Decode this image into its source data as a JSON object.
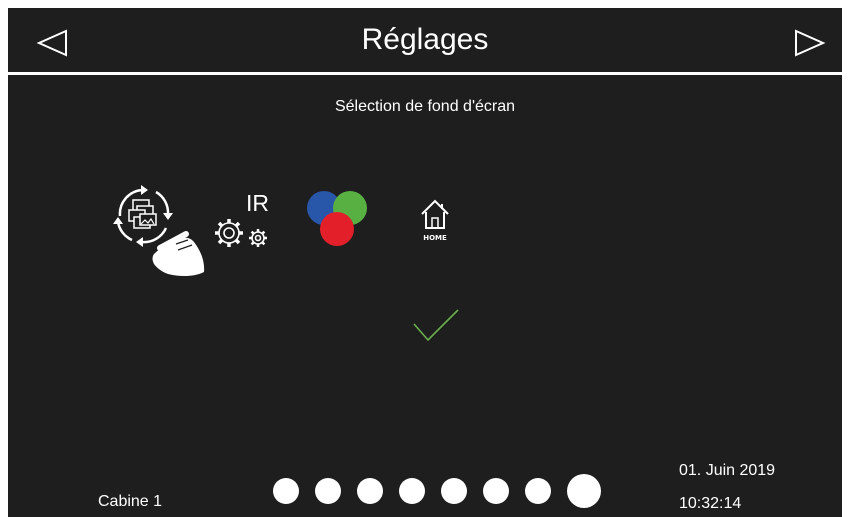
{
  "header": {
    "title": "Réglages",
    "prev_icon": "triangle-left-icon",
    "next_icon": "triangle-right-icon"
  },
  "main": {
    "subtitle": "Sélection de fond d'écran",
    "icons": [
      {
        "name": "wallpaper-swipe-icon"
      },
      {
        "name": "ir-settings-icon",
        "label": "IR"
      },
      {
        "name": "rgb-color-icon"
      },
      {
        "name": "home-icon",
        "label": "HOME"
      }
    ],
    "confirm_icon": "checkmark-icon",
    "confirm_color": "#6ab04c"
  },
  "footer": {
    "cabin_label": "Cabine 1",
    "pages": {
      "count": 8,
      "active": 8
    },
    "date": "01. Juin 2019",
    "time": "10:32:14"
  },
  "colors": {
    "background": "#1e1e1e",
    "foreground": "#ffffff",
    "rgb_blue": "#2856a8",
    "rgb_green": "#58b043",
    "rgb_red": "#e3202a"
  }
}
